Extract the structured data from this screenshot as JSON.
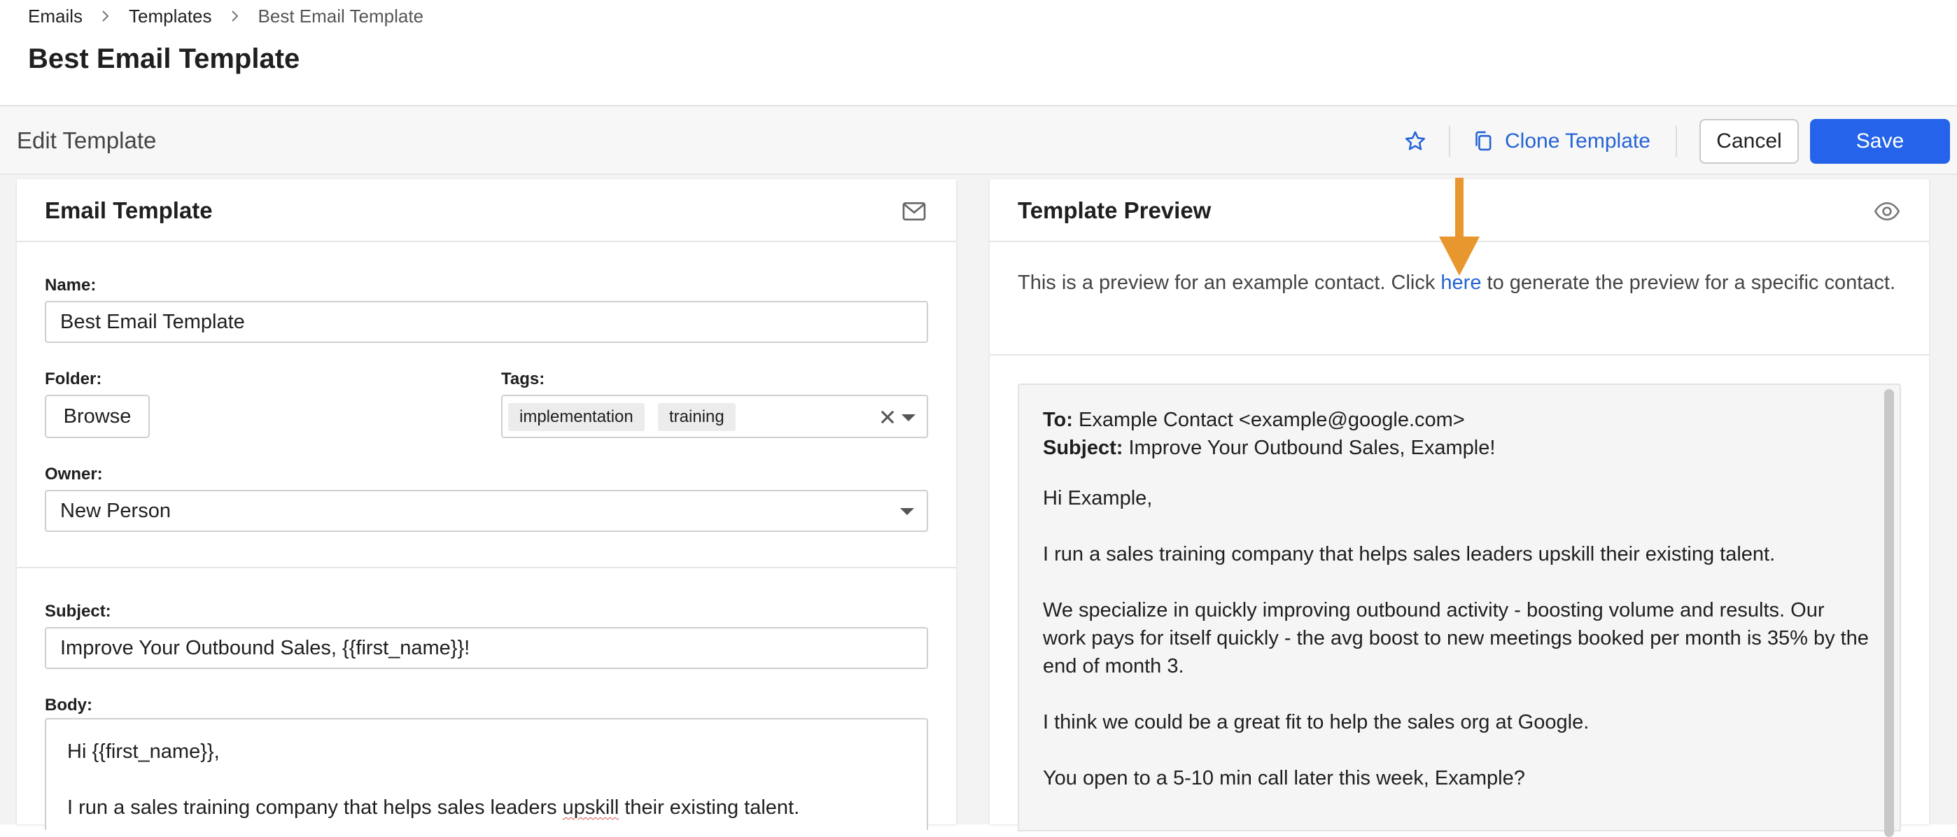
{
  "breadcrumb": {
    "items": [
      "Emails",
      "Templates",
      "Best Email Template"
    ]
  },
  "page": {
    "title": "Best Email Template"
  },
  "editbar": {
    "title": "Edit Template",
    "clone_label": "Clone Template",
    "cancel_label": "Cancel",
    "save_label": "Save"
  },
  "email_template": {
    "title": "Email Template",
    "name_label": "Name:",
    "name_value": "Best Email Template",
    "folder_label": "Folder:",
    "browse_label": "Browse",
    "tags_label": "Tags:",
    "tags": [
      "implementation",
      "training"
    ],
    "owner_label": "Owner:",
    "owner_value": "New Person",
    "subject_label": "Subject:",
    "subject_value": "Improve Your Outbound Sales, {{first_name}}!",
    "body_label": "Body:",
    "body_greeting": "Hi {{first_name}},",
    "body_line1_pre": "I run a sales training company that helps sales leaders ",
    "body_line1_spell": "upskill",
    "body_line1_post": " their existing talent."
  },
  "preview": {
    "title": "Template Preview",
    "intro_pre": "This is a preview for an example contact. Click ",
    "intro_link": "here",
    "intro_post": " to generate the preview for a specific contact.",
    "to_label": "To:",
    "to_value": "Example Contact <example@google.com>",
    "subject_label": "Subject:",
    "subject_value": "Improve Your Outbound Sales, Example!",
    "greeting": "Hi Example,",
    "para1": "I run a sales training company that helps sales leaders upskill their existing talent.",
    "para2": "We specialize in quickly improving outbound activity - boosting volume and results. Our work pays for itself quickly - the avg boost to new meetings booked per month is 35% by the end of month 3.",
    "para3": "I think we could be a great fit to help the sales org at Google.",
    "para4": "You open to a 5-10 min call later this week, Example?"
  },
  "colors": {
    "accent": "#2563eb",
    "link": "#2563d6",
    "annotation_arrow": "#e8962e"
  },
  "icons": [
    "chevron-right-icon",
    "star-icon",
    "copy-icon",
    "mail-icon",
    "eye-icon",
    "close-icon",
    "caret-down-icon",
    "arrow-down-icon"
  ]
}
